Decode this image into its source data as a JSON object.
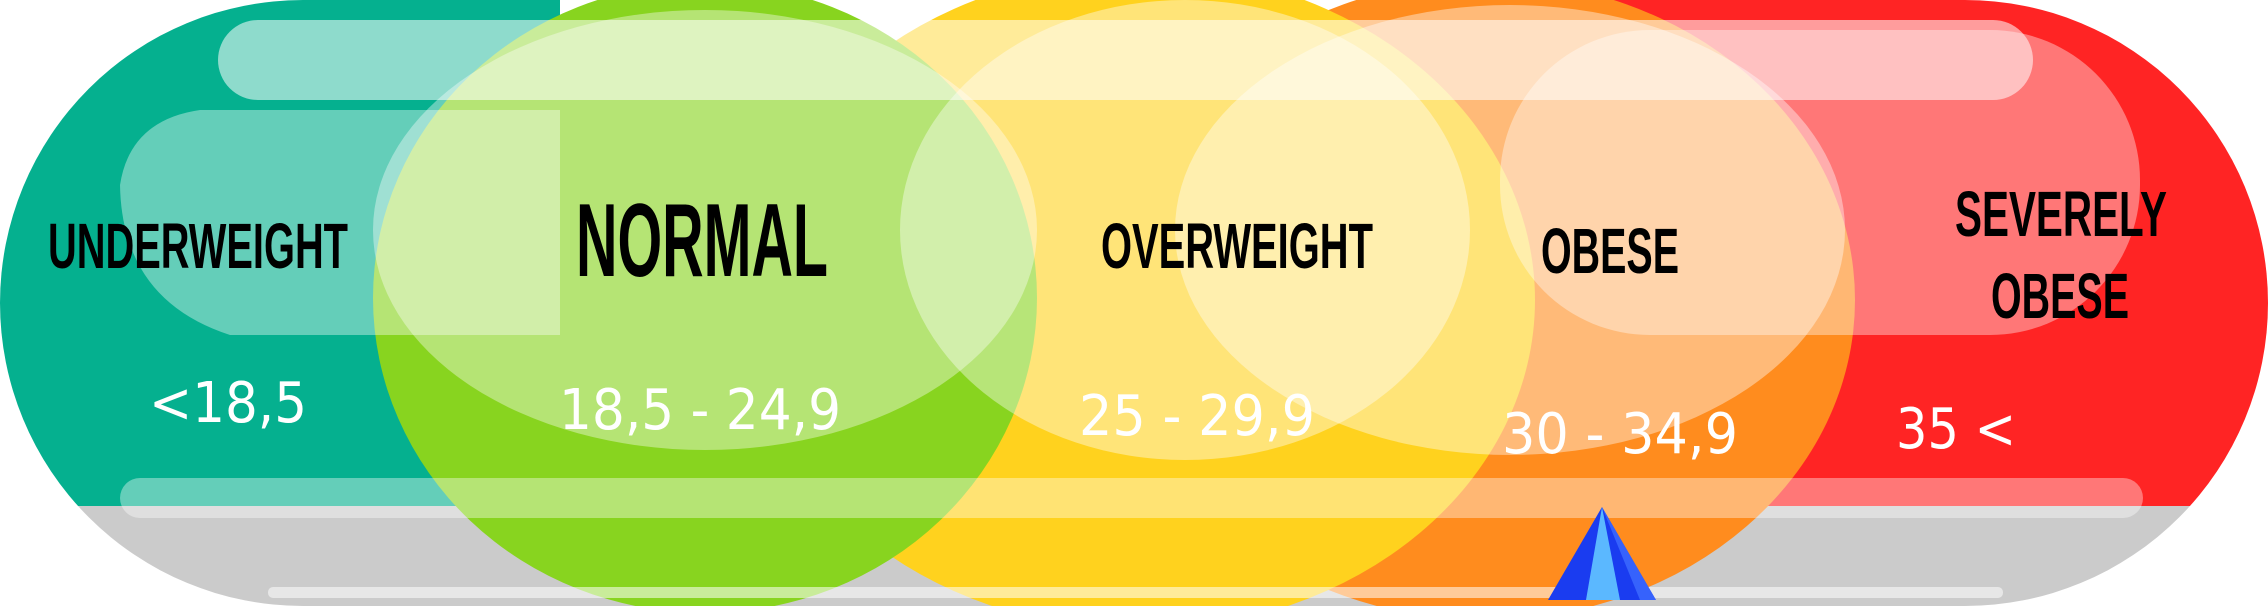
{
  "categories": [
    {
      "id": "underweight",
      "name": "UNDERWEIGHT",
      "range": "<18,5",
      "color": "#05B08F"
    },
    {
      "id": "normal",
      "name": "NORMAL",
      "range": "18,5 - 24,9",
      "color": "#88D41F"
    },
    {
      "id": "overweight",
      "name": "OVERWEIGHT",
      "range": "25 - 29,9",
      "color": "#FFD21E"
    },
    {
      "id": "obese",
      "name": "OBESE",
      "range": "30 - 34,9",
      "color": "#FF8C1E"
    },
    {
      "id": "severely-obese",
      "name_line1": "SEVERELY",
      "name_line2": "OBESE",
      "range": "35 <",
      "color": "#FF2424"
    }
  ],
  "indicator": {
    "icon": "triangle-pointer-icon",
    "color": "#1A3CF0",
    "highlight": "#5BB8FF"
  },
  "base_color": "#CBCBCB"
}
